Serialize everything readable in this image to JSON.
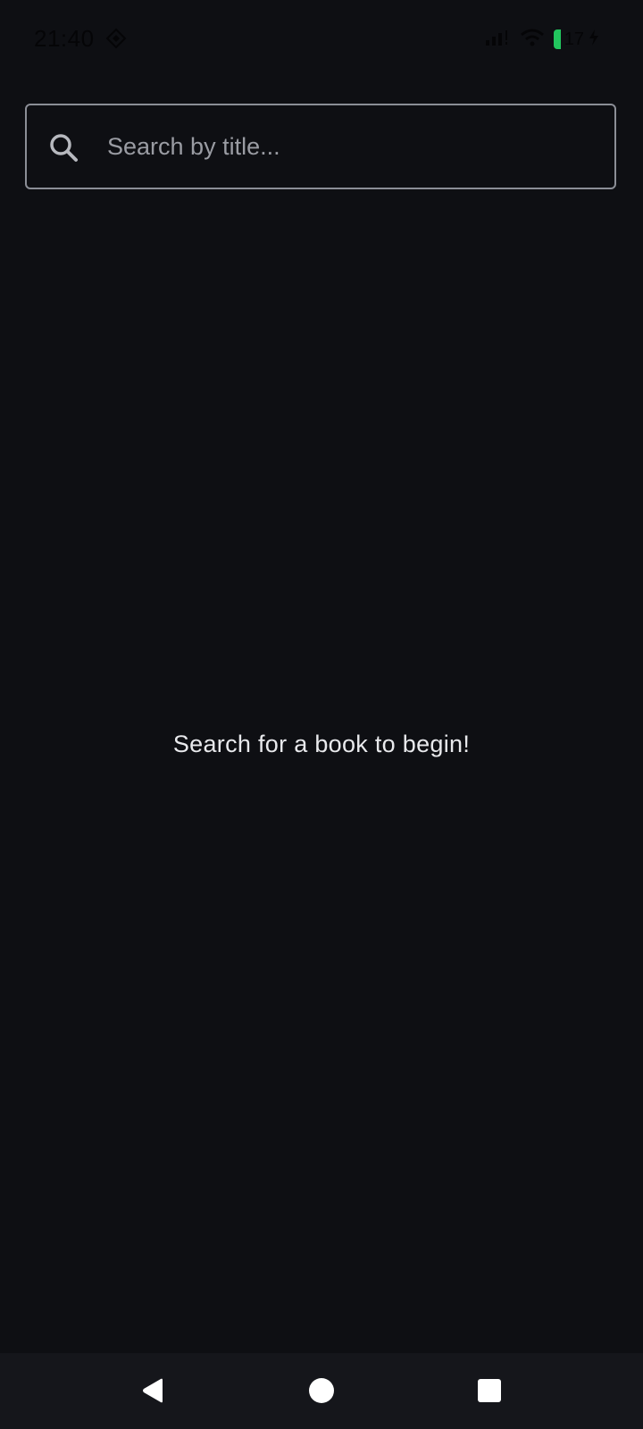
{
  "status_bar": {
    "time": "21:40",
    "battery_level": "17",
    "battery_color": "#22c55e",
    "icons": [
      "app-notification-icon",
      "signal-icon",
      "wifi-icon",
      "battery-icon",
      "charging-icon"
    ]
  },
  "search": {
    "placeholder": "Search by title...",
    "value": "",
    "icon": "search-icon"
  },
  "main": {
    "empty_message": "Search for a book to begin!"
  },
  "nav_bar": {
    "buttons": [
      "back-icon",
      "home-icon",
      "recents-icon"
    ]
  },
  "colors": {
    "background": "#0e0f13",
    "nav_background": "#15161b",
    "border": "#8b8e96",
    "text": "#e8e9ec",
    "placeholder": "#9a9ca3"
  }
}
